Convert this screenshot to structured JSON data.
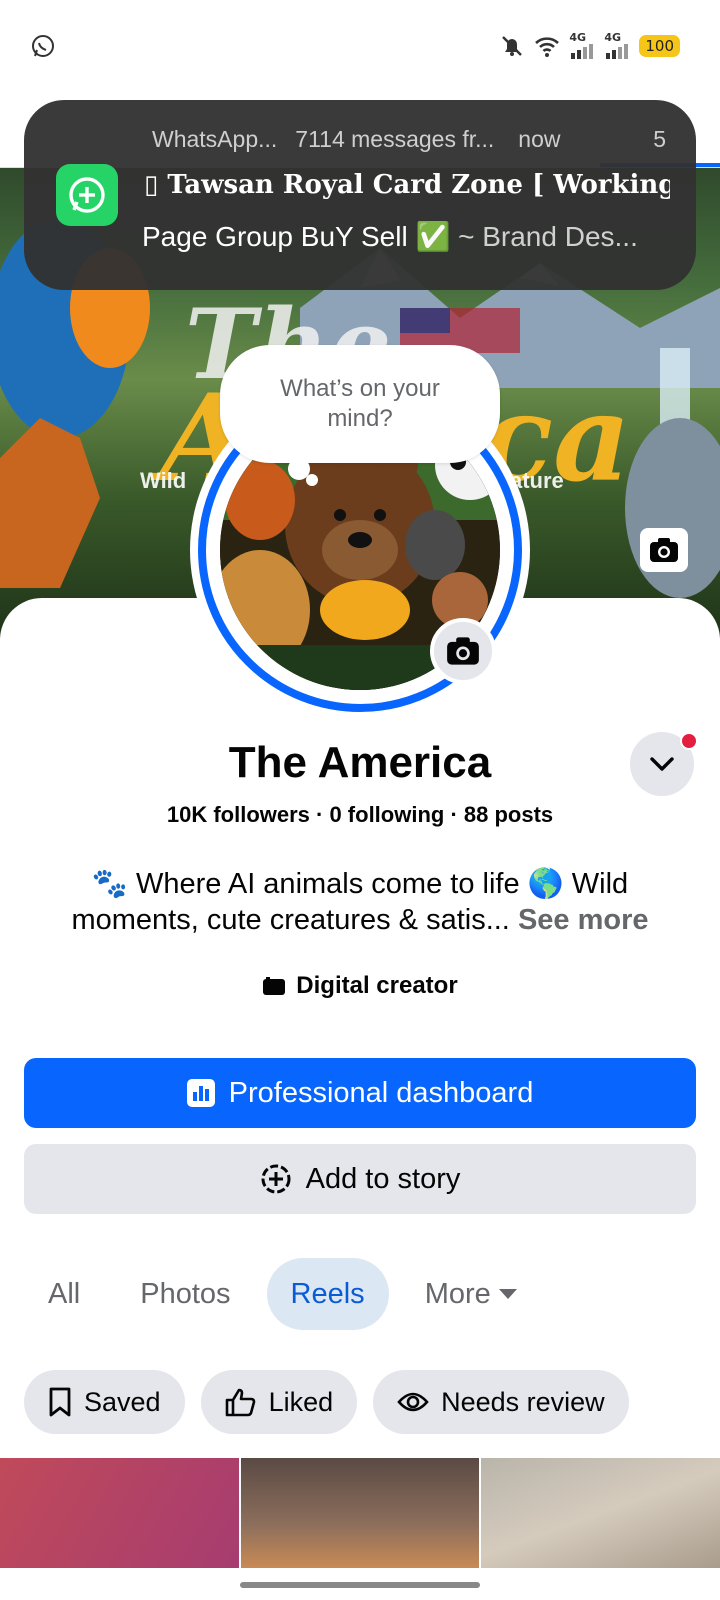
{
  "status_bar": {
    "left_icon": "whatsapp-icon",
    "signal1_label": "4G",
    "signal2_label": "4G",
    "battery": "100"
  },
  "notification": {
    "app": "WhatsApp...",
    "messages": "7114 messages fr...",
    "time": "now",
    "count": "5",
    "title": "▯ Tawsan Royal Card Zone [ Working ...",
    "body_group": "Page Group BuY Sell ✅",
    "body_sender": " ~ Brand Des..."
  },
  "bubble": {
    "text": "What’s on your mind?"
  },
  "profile": {
    "name": "The America",
    "stats": "10K followers · 0 following · 88 posts",
    "bio": "🐾 Where AI animals come to life 🌎 Wild moments, cute creatures & satis...",
    "see_more": "See more",
    "category": "Digital creator"
  },
  "buttons": {
    "primary": "Professional dashboard",
    "secondary": "Add to story"
  },
  "tabs": [
    {
      "label": "All"
    },
    {
      "label": "Photos"
    },
    {
      "label": "Reels"
    },
    {
      "label": "More"
    }
  ],
  "chips": [
    {
      "label": "Saved"
    },
    {
      "label": "Liked"
    },
    {
      "label": "Needs review"
    }
  ],
  "colors": {
    "accent": "#0866ff",
    "chip_bg": "#e4e6eb",
    "active_tab_bg": "#dbe7f2",
    "whatsapp": "#25d366"
  }
}
